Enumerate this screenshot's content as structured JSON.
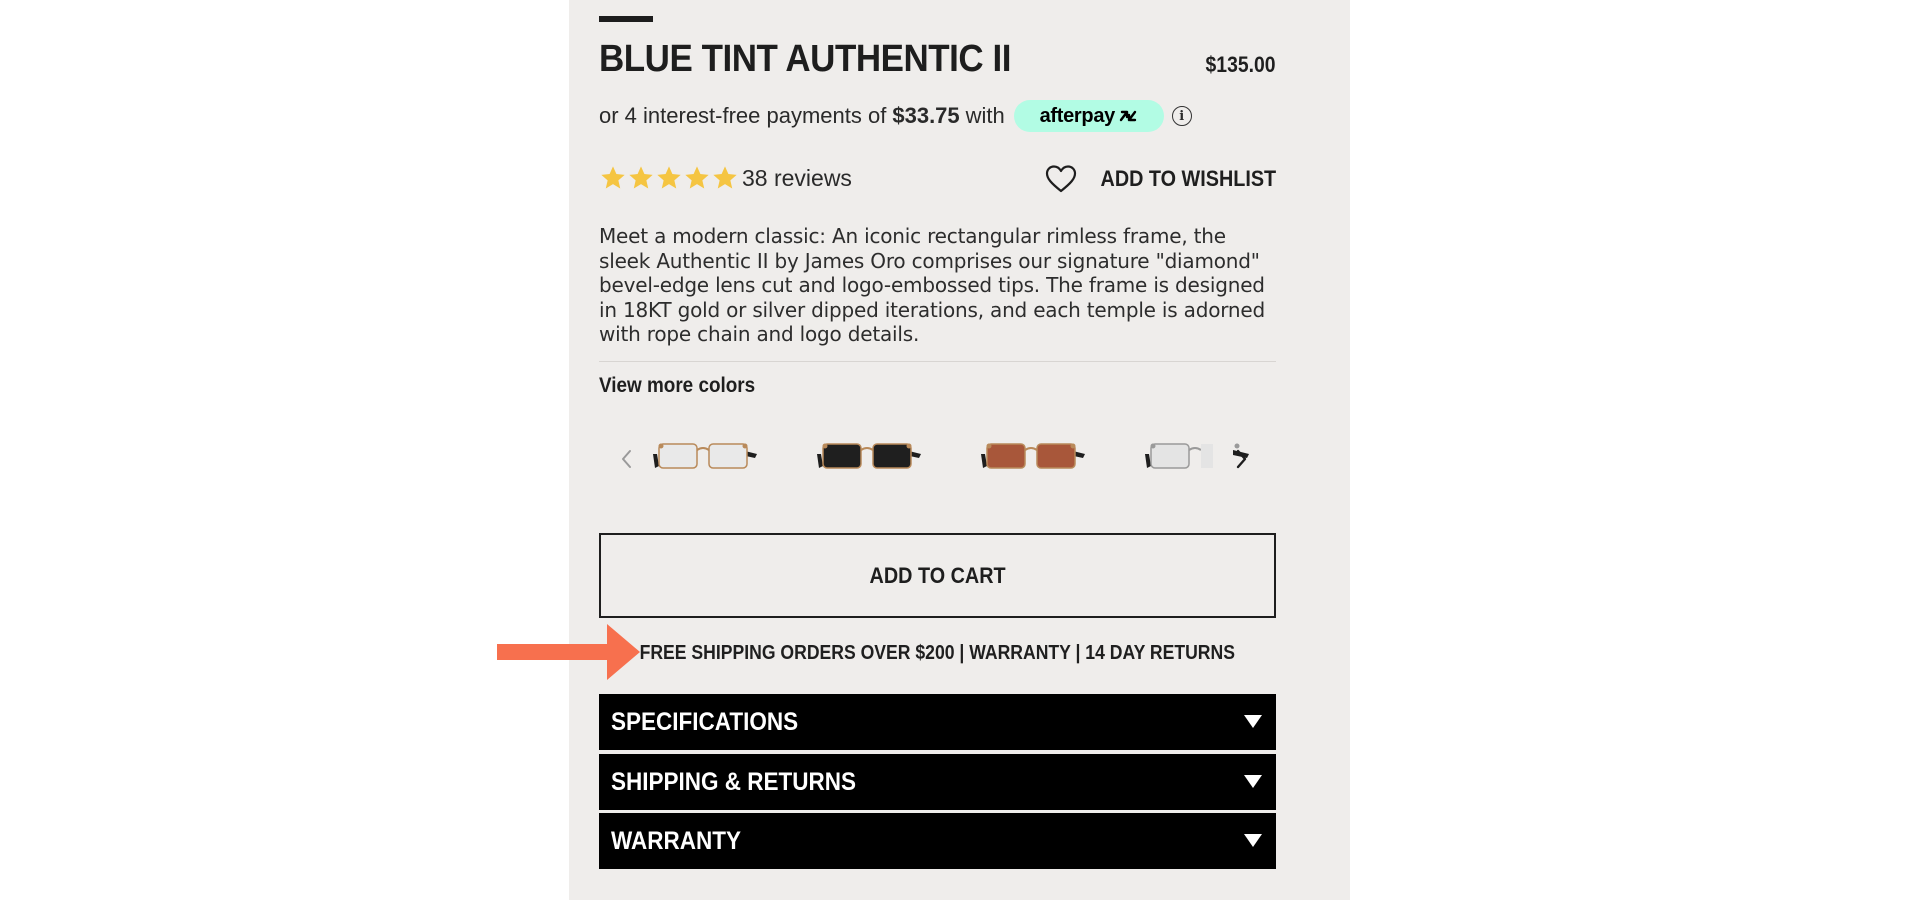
{
  "product": {
    "title": "BLUE TINT AUTHENTIC II",
    "price": "$135.00"
  },
  "afterpay": {
    "prefix": "or 4 interest-free payments of",
    "amount": "$33.75",
    "suffix": "with",
    "brand": "afterpay",
    "brand_color": "#b2fce4"
  },
  "rating": {
    "stars": 5,
    "star_color": "#f5c542",
    "reviews_label": "38 reviews"
  },
  "wishlist": {
    "label": "ADD TO WISHLIST"
  },
  "description": "Meet a modern classic: An iconic rectangular rimless frame, the sleek Authentic II by James Oro comprises our signature \"diamond\" bevel-edge lens cut and logo-embossed tips. The frame is designed in 18KT gold or silver dipped iterations, and each temple is adorned with rope chain and logo details.",
  "colors": {
    "heading": "View more colors",
    "swatches": [
      {
        "name": "clear-lens-gold",
        "lens": "#e9e9e9",
        "frame": "#b98a5a"
      },
      {
        "name": "black-lens-gold",
        "lens": "#1f1f1f",
        "frame": "#b98a5a"
      },
      {
        "name": "brown-lens-gold",
        "lens": "#a8573a",
        "frame": "#b98a5a"
      },
      {
        "name": "clear-lens-silver",
        "lens": "#e4e4e4",
        "frame": "#9a9a9a"
      }
    ]
  },
  "cart": {
    "label": "ADD TO CART"
  },
  "shipping_note": "FREE SHIPPING ORDERS OVER $200 | WARRANTY | 14 DAY RETURNS",
  "accordions": [
    {
      "label": "SPECIFICATIONS"
    },
    {
      "label": "SHIPPING & RETURNS"
    },
    {
      "label": "WARRANTY"
    }
  ],
  "annotation_arrow_color": "#f7704e"
}
